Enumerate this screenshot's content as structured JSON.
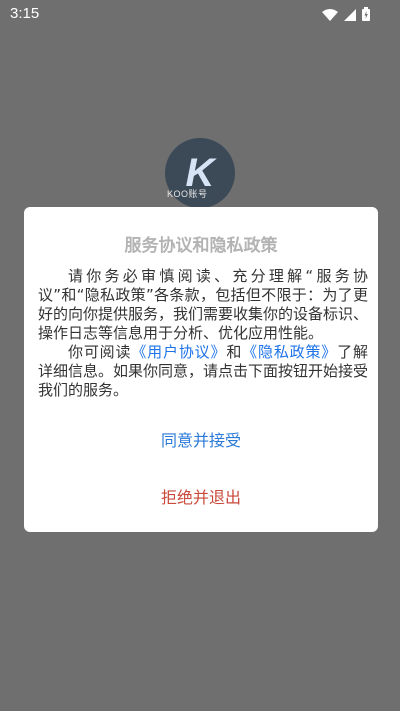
{
  "status_bar": {
    "time": "3:15",
    "icons": [
      "wifi-icon",
      "signal-icon",
      "battery-icon"
    ]
  },
  "background": {
    "logo_letter": "K",
    "logo_caption": "KOO账号"
  },
  "dialog": {
    "title": "服务协议和隐私政策",
    "para1": "请你务必审慎阅读、充分理解“服务协议”和“隐私政策”各条款，包括但不限于：为了更好的向你提供服务，我们需要收集你的设备标识、操作日志等信息用于分析、优化应用性能。",
    "para2_prefix": "你可阅读",
    "user_agreement_link": "《用户协议》",
    "para2_and": "和",
    "privacy_policy_link": "《隐私政策》",
    "para2_suffix": "了解详细信息。如果你同意，请点击下面按钮开始接受我们的服务。",
    "accept_button": "同意并接受",
    "reject_button": "拒绝并退出"
  },
  "colors": {
    "overlay": "#6f6f6f",
    "link": "#1e73e8",
    "accept": "#2a79d8",
    "reject": "#c94a3c",
    "title": "#b3b3b3"
  }
}
